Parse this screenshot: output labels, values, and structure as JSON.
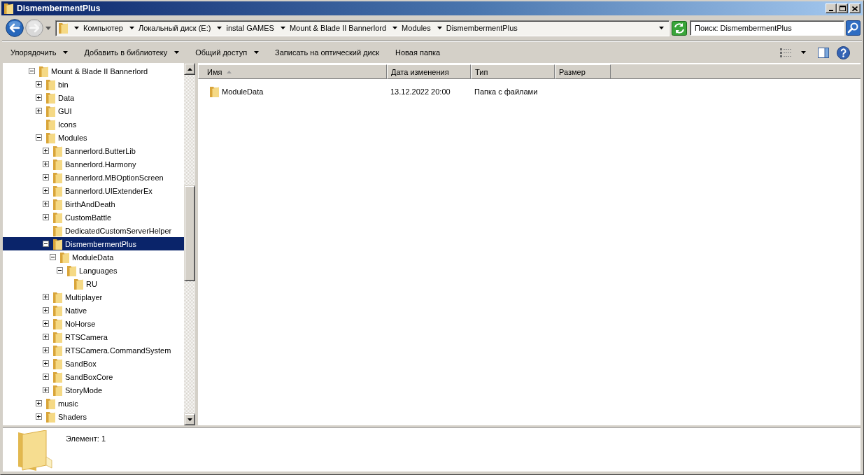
{
  "window": {
    "title": "DismembermentPlus"
  },
  "navigation": {
    "back": {
      "disabled": false
    },
    "forward": {
      "disabled": true
    }
  },
  "address_bar": {
    "path": [
      "Компьютер",
      "Локальный диск (E:)",
      "instal GAMES",
      "Mount & Blade II Bannerlord",
      "Modules",
      "DismembermentPlus"
    ]
  },
  "search_box": {
    "placeholder": "Поиск: DismembermentPlus"
  },
  "toolbar": [
    {
      "label": "Упорядочить",
      "dropdown": true
    },
    {
      "label": "Добавить в библиотеку",
      "dropdown": true
    },
    {
      "label": "Общий доступ",
      "dropdown": true
    },
    {
      "label": "Записать на оптический диск",
      "dropdown": false
    },
    {
      "label": "Новая папка",
      "dropdown": false
    }
  ],
  "tree": [
    {
      "label": "Mount & Blade II Bannerlord",
      "expandable": true,
      "expanded": true,
      "selected": false,
      "children": [
        {
          "label": "bin",
          "expandable": true,
          "expanded": false,
          "selected": false
        },
        {
          "label": "Data",
          "expandable": true,
          "expanded": false,
          "selected": false
        },
        {
          "label": "GUI",
          "expandable": true,
          "expanded": false,
          "selected": false
        },
        {
          "label": "Icons",
          "expandable": false,
          "expanded": false,
          "selected": false
        },
        {
          "label": "Modules",
          "expandable": true,
          "expanded": true,
          "selected": false,
          "children": [
            {
              "label": "Bannerlord.ButterLib",
              "expandable": true,
              "expanded": false,
              "selected": false
            },
            {
              "label": "Bannerlord.Harmony",
              "expandable": true,
              "expanded": false,
              "selected": false
            },
            {
              "label": "Bannerlord.MBOptionScreen",
              "expandable": true,
              "expanded": false,
              "selected": false
            },
            {
              "label": "Bannerlord.UIExtenderEx",
              "expandable": true,
              "expanded": false,
              "selected": false
            },
            {
              "label": "BirthAndDeath",
              "expandable": true,
              "expanded": false,
              "selected": false
            },
            {
              "label": "CustomBattle",
              "expandable": true,
              "expanded": false,
              "selected": false
            },
            {
              "label": "DedicatedCustomServerHelper",
              "expandable": false,
              "expanded": false,
              "selected": false
            },
            {
              "label": "DismembermentPlus",
              "expandable": true,
              "expanded": true,
              "selected": true,
              "children": [
                {
                  "label": "ModuleData",
                  "expandable": true,
                  "expanded": true,
                  "selected": false,
                  "children": [
                    {
                      "label": "Languages",
                      "expandable": true,
                      "expanded": true,
                      "selected": false,
                      "children": [
                        {
                          "label": "RU",
                          "expandable": false,
                          "expanded": false,
                          "selected": false
                        }
                      ]
                    }
                  ]
                }
              ]
            },
            {
              "label": "Multiplayer",
              "expandable": true,
              "expanded": false,
              "selected": false
            },
            {
              "label": "Native",
              "expandable": true,
              "expanded": false,
              "selected": false
            },
            {
              "label": "NoHorse",
              "expandable": true,
              "expanded": false,
              "selected": false
            },
            {
              "label": "RTSCamera",
              "expandable": true,
              "expanded": false,
              "selected": false
            },
            {
              "label": "RTSCamera.CommandSystem",
              "expandable": true,
              "expanded": false,
              "selected": false
            },
            {
              "label": "SandBox",
              "expandable": true,
              "expanded": false,
              "selected": false
            },
            {
              "label": "SandBoxCore",
              "expandable": true,
              "expanded": false,
              "selected": false
            },
            {
              "label": "StoryMode",
              "expandable": true,
              "expanded": false,
              "selected": false
            }
          ]
        },
        {
          "label": "music",
          "expandable": true,
          "expanded": false,
          "selected": false
        },
        {
          "label": "Shaders",
          "expandable": true,
          "expanded": false,
          "selected": false
        }
      ]
    }
  ],
  "table": {
    "columns": [
      {
        "label": "Имя",
        "sorted": true
      },
      {
        "label": "Дата изменения",
        "sorted": false
      },
      {
        "label": "Тип",
        "sorted": false
      },
      {
        "label": "Размер",
        "sorted": false
      }
    ],
    "rows": [
      {
        "name": "ModuleData",
        "date_modified": "13.12.2022 20:00",
        "type": "Папка с файлами",
        "selected": false
      }
    ]
  },
  "details_pane": {
    "item_count": "Элемент: 1"
  }
}
